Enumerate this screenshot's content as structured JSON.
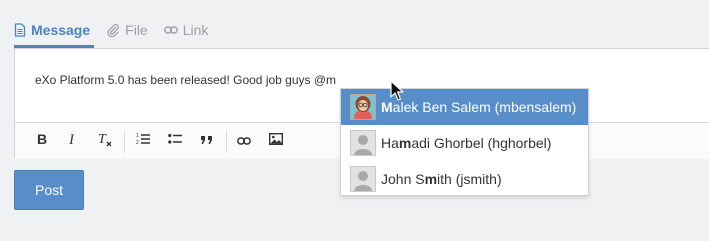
{
  "tabs": [
    {
      "label": "Message",
      "icon": "document-icon",
      "active": true
    },
    {
      "label": "File",
      "icon": "paperclip-icon",
      "active": false
    },
    {
      "label": "Link",
      "icon": "link-icon",
      "active": false
    }
  ],
  "editor": {
    "text": "eXo Platform 5.0 has been released! Good job guys @m"
  },
  "toolbar": {
    "buttons": [
      {
        "name": "bold-button",
        "icon": "bold-icon"
      },
      {
        "name": "italic-button",
        "icon": "italic-icon"
      },
      {
        "name": "remove-format-button",
        "icon": "remove-format-icon"
      },
      {
        "name": "numbered-list-button",
        "icon": "numbered-list-icon"
      },
      {
        "name": "bulleted-list-button",
        "icon": "bulleted-list-icon"
      },
      {
        "name": "blockquote-button",
        "icon": "quote-icon"
      },
      {
        "name": "insert-link-button",
        "icon": "link-icon"
      },
      {
        "name": "insert-image-button",
        "icon": "image-icon"
      }
    ]
  },
  "post_button": {
    "label": "Post"
  },
  "mentions": {
    "items": [
      {
        "prefix": "",
        "match": "M",
        "rest": "alek Ben Salem (mbensalem)",
        "selected": true
      },
      {
        "prefix": "Ha",
        "match": "m",
        "rest": "adi Ghorbel (hghorbel)",
        "selected": false
      },
      {
        "prefix": "John S",
        "match": "m",
        "rest": "ith (jsmith)",
        "selected": false
      }
    ]
  },
  "colors": {
    "accent": "#4a84c4",
    "button": "#578dc9",
    "selected_row": "#578dc9"
  }
}
